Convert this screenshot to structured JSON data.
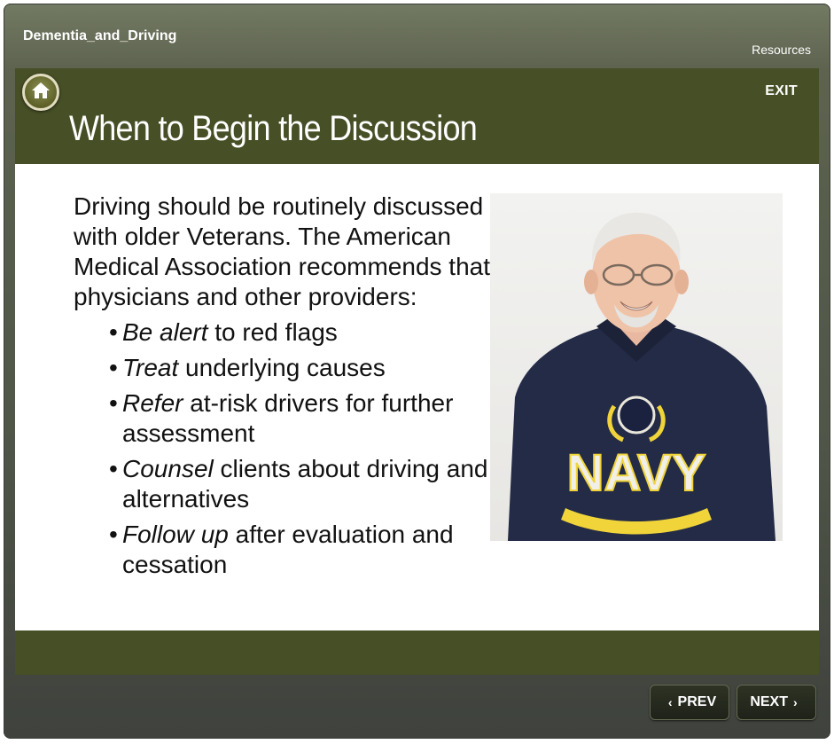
{
  "course": {
    "title": "Dementia_and_Driving",
    "resources_label": "Resources"
  },
  "header": {
    "exit_label": "EXIT",
    "slide_title": "When to Begin the Discussion"
  },
  "content": {
    "intro": "Driving should be routinely discussed with older Veterans. The American Medical Association recommends that physicians and other providers:",
    "bullets": [
      {
        "bullet": "•",
        "emph": "Be alert",
        "rest": " to red flags"
      },
      {
        "bullet": "•",
        "emph": "Treat",
        "rest": " underlying causes"
      },
      {
        "bullet": "•",
        "emph": "Refer",
        "rest": " at-risk drivers for further assessment"
      },
      {
        "bullet": "•",
        "emph": "Counsel",
        "rest": " clients about driving and alternatives"
      },
      {
        "bullet": "•",
        "emph": "Follow up",
        "rest": " after evaluation and cessation"
      }
    ],
    "photo_text": "NAVY"
  },
  "nav": {
    "prev_label": "PREV",
    "next_label": "NEXT",
    "prev_icon": "‹",
    "next_icon": "›"
  },
  "colors": {
    "header_bg": "#464f26",
    "frame_bg": "#5d634f",
    "sweatshirt": "#222a45",
    "navy_gold": "#f0d43a"
  }
}
